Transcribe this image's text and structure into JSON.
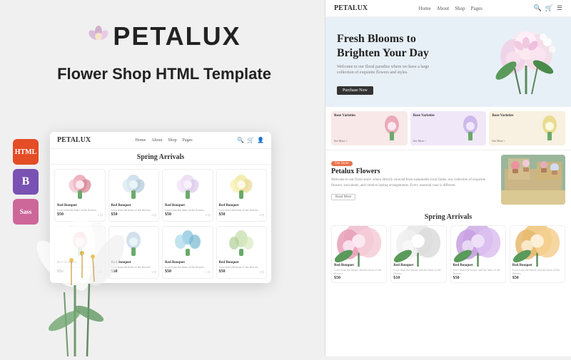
{
  "brand": {
    "name": "PETALUX",
    "letter_p": "P",
    "letter_rest": "ETALUX"
  },
  "left": {
    "tagline": "Flower Shop HTML Template",
    "badges": [
      {
        "label": "HTML",
        "type": "html"
      },
      {
        "label": "B",
        "type": "bootstrap"
      },
      {
        "label": "Sass",
        "type": "sass"
      }
    ],
    "inner_mockup": {
      "logo": "PETALUX",
      "nav_items": [
        "Home",
        "About",
        "Shop",
        "Pages"
      ],
      "section_title": "Spring Arrivals",
      "products": [
        {
          "name": "Red Bouquet",
          "price": "$50"
        },
        {
          "name": "Red Bouquet",
          "price": "$50"
        },
        {
          "name": "Red Bouquet",
          "price": "$50"
        },
        {
          "name": "Red Bouquet",
          "price": "$50"
        },
        {
          "name": "Red Bouquet",
          "price": "$50"
        },
        {
          "name": "Red Bouquet",
          "price": "$50"
        },
        {
          "name": "Red Bouquet",
          "price": "$50"
        },
        {
          "name": "Red Bouquet",
          "price": "$50"
        }
      ]
    }
  },
  "right": {
    "site_logo": "PETALUX",
    "nav_items": [
      "Home",
      "About",
      "Shop",
      "Pages"
    ],
    "hero": {
      "title_line1": "Fresh Blooms to",
      "title_line2": "Brighten Your Day",
      "subtitle": "Welcome to our floral paradise where we have a large collection of exquisite flowers and styles.",
      "cta_label": "Purchase Now"
    },
    "feature_boxes": [
      {
        "label": "Rose Varieties",
        "btn": "See More >"
      },
      {
        "label": "Rose Varieties",
        "btn": "See More >"
      },
      {
        "label": "Rose Varieties",
        "btn": "See More >"
      }
    ],
    "about": {
      "badge": "Our Store",
      "title": "Petalux Flowers",
      "desc": "Welcome to our floral store! where directly sourced from sustainable local farms, our collection of exquisite flowers, succulents, and creative lasting arrangements. Every seasonal vase is different.",
      "btn_label": "Read More"
    },
    "arrivals": {
      "title": "Spring Arrivals",
      "products": [
        {
          "name": "Red Bouquet",
          "price": "$50"
        },
        {
          "name": "Red Bouquet",
          "price": "$10"
        },
        {
          "name": "Red Bouquet",
          "price": "$50"
        },
        {
          "name": "Red Bouquet",
          "price": "$50"
        }
      ]
    }
  }
}
